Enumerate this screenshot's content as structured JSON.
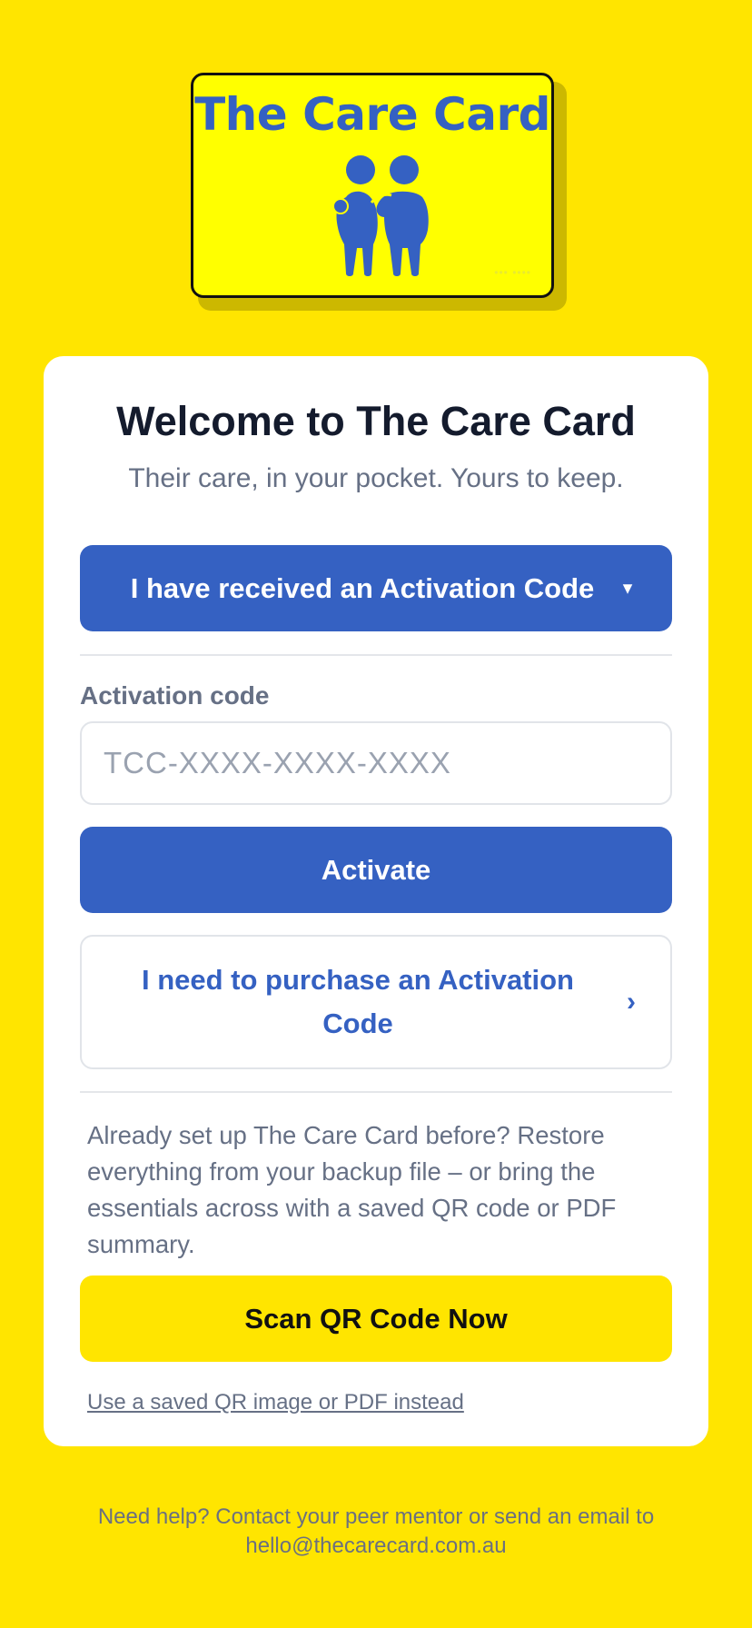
{
  "logo": {
    "title": "The Care Card",
    "icon": "two-people-icon",
    "dots": "••• ••••"
  },
  "welcome": {
    "title": "Welcome to The Care Card",
    "subtitle": "Their care, in your pocket. Yours to keep."
  },
  "received_toggle": {
    "label": "I have received an Activation Code",
    "icon": "caret-down-icon",
    "caret": "▼"
  },
  "activation": {
    "label": "Activation code",
    "placeholder": "TCC-XXXX-XXXX-XXXX",
    "value": "",
    "button_label": "Activate"
  },
  "purchase": {
    "label": "I need to purchase an Activation Code",
    "icon": "chevron-right-icon",
    "chevron": "›"
  },
  "restore": {
    "text": "Already set up The Care Card before? Restore everything from your backup file – or bring the essentials across with a saved QR code or PDF summary.",
    "scan_label": "Scan QR Code Now",
    "alt_link": "Use a saved QR image or PDF instead"
  },
  "help": {
    "line1": "Need help? Contact your peer mentor or send an email to",
    "email": "hello@thecarecard.com.au"
  },
  "colors": {
    "background": "#FFE500",
    "primary": "#3561C2",
    "card": "#FFFFFF",
    "logo_card": "#FFFF00",
    "muted_text": "#667085"
  }
}
